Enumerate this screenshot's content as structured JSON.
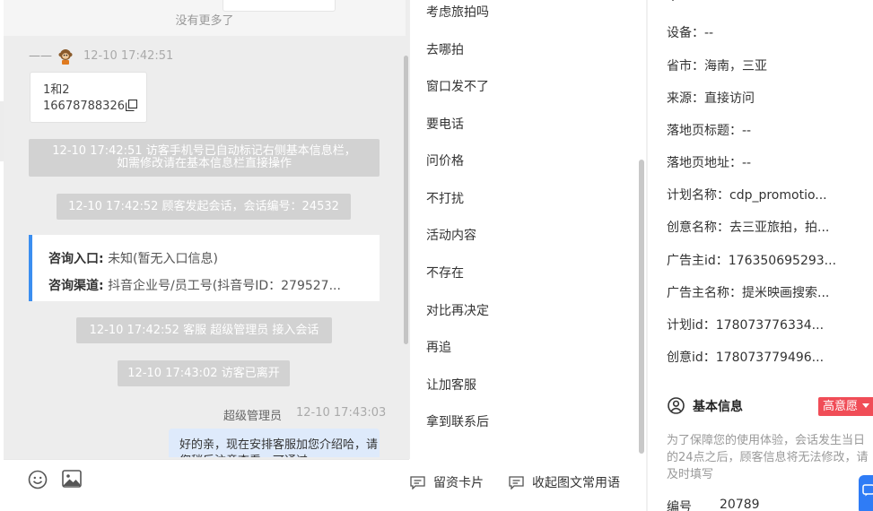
{
  "chat": {
    "no_more": "没有更多了",
    "visitor_name": "——",
    "visitor_time": "12-10 17:42:51",
    "visitor_message_line1": "1和2",
    "visitor_message_line2": "16678788326",
    "system_1_line1": "12-10 17:42:51 访客手机号已自动标记右侧基本信息栏，",
    "system_1_line2": "如需修改请在基本信息栏直接操作",
    "system_2": "12-10 17:42:52 顾客发起会话，会话编号：24532",
    "consult_entry_label": "咨询入口:",
    "consult_entry_value": "未知(暂无入口信息)",
    "consult_channel_label": "咨询渠道:",
    "consult_channel_value": "抖音企业号/员工号(抖音号ID：279527...",
    "system_3": "12-10 17:42:52 客服 超级管理员 接入会话",
    "system_4": "12-10 17:43:02 访客已离开",
    "agent_name": "超级管理员",
    "agent_time": "12-10 17:43:03",
    "agent_message": "好的亲，现在安排客服加您介绍哈，请您稍后注意查看，可通过"
  },
  "input_bar": {
    "card_button": "留资卡片",
    "phrases_button": "收起图文常用语",
    "typed_ghost": "……"
  },
  "phrases": [
    "考虑旅拍吗",
    "去哪拍",
    "窗口发不了",
    "要电话",
    "问价格",
    "不打扰",
    "活动内容",
    "不存在",
    "对比再决定",
    "再追",
    "让加客服",
    "拿到联系后"
  ],
  "info": {
    "rows": [
      "设备：--",
      "省市：海南，三亚",
      "来源：直接访问",
      "落地页标题：--",
      "落地页地址：--",
      "计划名称：cdp_promotio...",
      "创意名称：去三亚旅拍，拍...",
      "广告主id：176350695293...",
      "广告主名称：提米映画搜索...",
      "计划id：178073776334...",
      "创意id：178073779496..."
    ],
    "section_title": "基本信息",
    "intent_badge": "高意愿",
    "notice": "为了保障您的使用体验，会话发生当日的24点之后，顾客信息将无法修改，请及时填写",
    "id_label": "编号",
    "id_value": "20789"
  },
  "colors": {
    "accent": "#3b8ef0",
    "badge": "#f04d57",
    "agent_bubble": "#deeafb",
    "system_bar": "#d2d2d2"
  }
}
